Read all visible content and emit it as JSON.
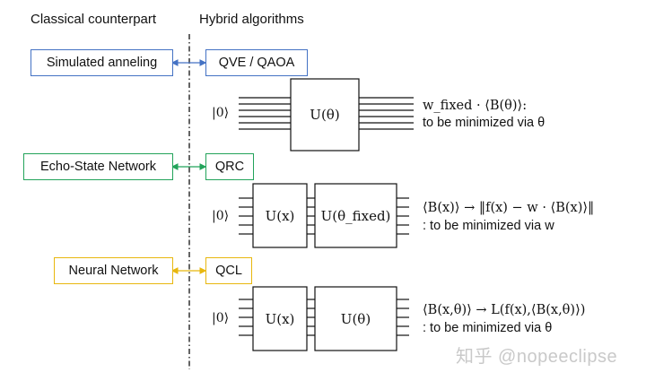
{
  "headers": {
    "classical": "Classical counterpart",
    "hybrid": "Hybrid algorithms"
  },
  "pairs": [
    {
      "classical": "Simulated anneling",
      "hybrid": "QVE / QAOA",
      "color": "#4472C4"
    },
    {
      "classical": "Echo-State Network",
      "hybrid": "QRC",
      "color": "#22A35A"
    },
    {
      "classical": "Neural Network",
      "hybrid": "QCL",
      "color": "#E8B70E"
    }
  ],
  "circuits": [
    {
      "input": "|0⟩",
      "gates": [
        "U(θ)"
      ],
      "line1": "w_fixed · ⟨B(θ)⟩:",
      "line2": "to be minimized via θ"
    },
    {
      "input": "|0⟩",
      "gates": [
        "U(x)",
        "U(θ_fixed)"
      ],
      "line1": "⟨B(x)⟩ → ‖f(x) − w · ⟨B(x)⟩‖",
      "line2": ": to be minimized via w"
    },
    {
      "input": "|0⟩",
      "gates": [
        "U(x)",
        "U(θ)"
      ],
      "line1": "⟨B(x,θ)⟩ → L(f(x),⟨B(x,θ)⟩)",
      "line2": ": to be minimized via θ"
    }
  ],
  "watermark": "知乎 @nopeeclipse"
}
